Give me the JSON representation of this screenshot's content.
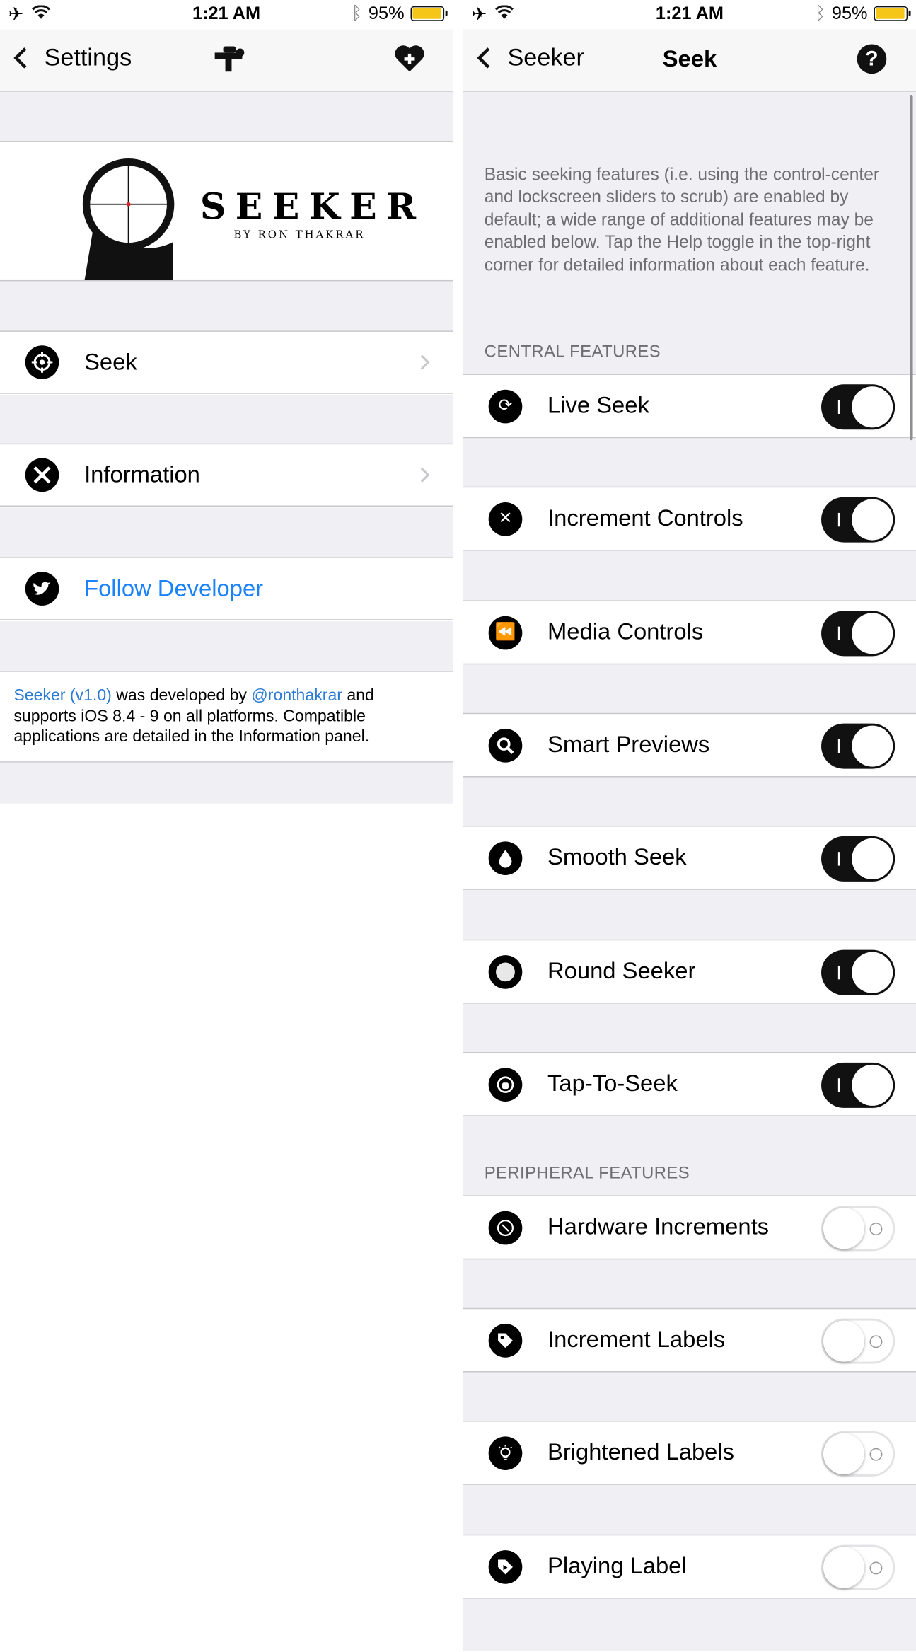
{
  "status": {
    "time": "1:21 AM",
    "battery": "95%",
    "battery_level": 0.95,
    "battery_color": "#f5c518"
  },
  "left": {
    "back_label": "Settings",
    "nav_logo_icon": "sniper-rifle-icon",
    "heart_icon": "heart-plus-icon",
    "banner": {
      "title": "SEEKER",
      "byline": "BY RON THAKRAR",
      "icon": "scope-crosshair-icon"
    },
    "items": [
      {
        "label": "Seek",
        "icon": "crosshair-icon"
      },
      {
        "label": "Information",
        "icon": "tools-icon"
      },
      {
        "label": "Follow Developer",
        "icon": "twitter-bird-icon"
      }
    ],
    "footer": {
      "link1": "Seeker (v1.0)",
      "text1": " was developed by ",
      "link2": "@ronthakrar",
      "text2": " and supports iOS 8.4 - 9 on all platforms. Compatible applications are detailed in the Information panel."
    }
  },
  "right": {
    "back_label": "Seeker",
    "title": "Seek",
    "help_icon": "question-mark-icon",
    "description": "Basic seeking features (i.e. using the control-center and lockscreen sliders to scrub) are enabled by default; a wide range of additional features may be enabled below. Tap the Help toggle in the top-right corner for detailed information about each feature.",
    "sections": [
      {
        "header": "CENTRAL FEATURES",
        "items": [
          {
            "label": "Live Seek",
            "icon": "refresh-icon",
            "on": true
          },
          {
            "label": "Increment Controls",
            "icon": "expand-arrows-icon",
            "on": true
          },
          {
            "label": "Media Controls",
            "icon": "fast-forward-icon",
            "on": true
          },
          {
            "label": "Smart Previews",
            "icon": "magnifier-icon",
            "on": true
          },
          {
            "label": "Smooth Seek",
            "icon": "droplet-icon",
            "on": true
          },
          {
            "label": "Round Seeker",
            "icon": "circle-icon",
            "on": true
          },
          {
            "label": "Tap-To-Seek",
            "icon": "hand-tap-icon",
            "on": true
          }
        ]
      },
      {
        "header": "PERIPHERAL FEATURES",
        "items": [
          {
            "label": "Hardware Increments",
            "icon": "compass-icon",
            "on": false
          },
          {
            "label": "Increment Labels",
            "icon": "tag-icon",
            "on": false
          },
          {
            "label": "Brightened Labels",
            "icon": "lightbulb-icon",
            "on": false
          },
          {
            "label": "Playing Label",
            "icon": "tag-play-icon",
            "on": false
          }
        ]
      }
    ]
  }
}
